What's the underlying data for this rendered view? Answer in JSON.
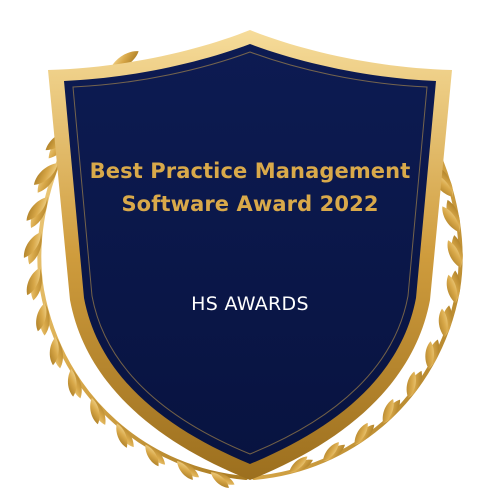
{
  "award": {
    "title_line1": "Best Practice Management",
    "title_line2": "Software Award 2022",
    "issuer": "HS AWARDS"
  },
  "colors": {
    "shield_fill": "#0a1748",
    "gold": "#d9a94a",
    "gold_light": "#f0cf85",
    "gold_dark": "#a87a22",
    "issuer_text": "#ffffff"
  },
  "icons": {
    "left_wreath": "laurel-branch-icon",
    "right_wreath": "laurel-branch-icon",
    "shield": "shield-icon"
  }
}
